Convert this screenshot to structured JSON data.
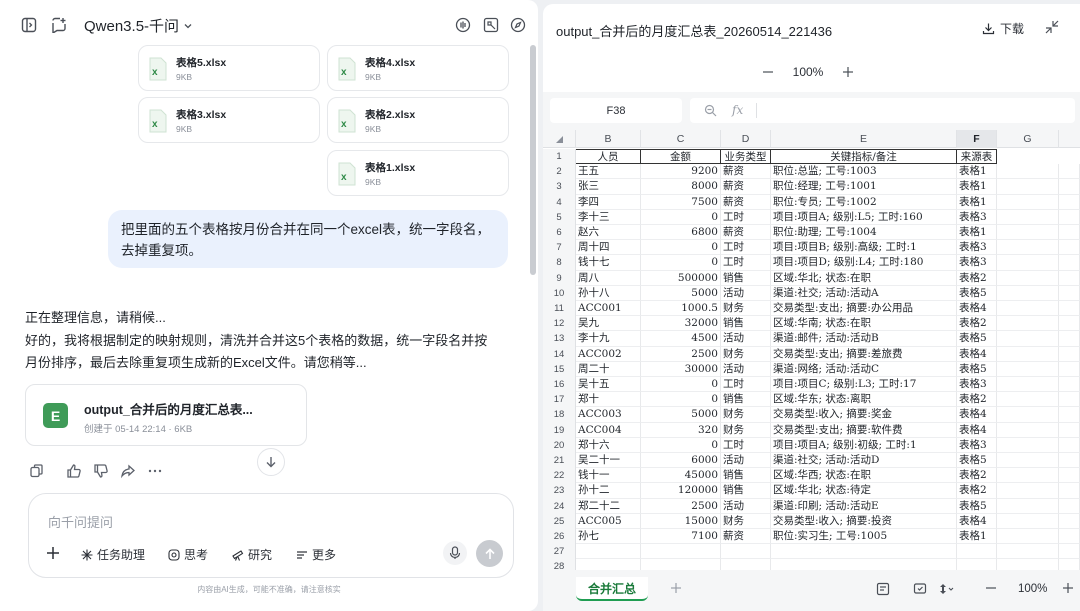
{
  "left": {
    "model_name": "Qwen3.5-千问",
    "files": [
      {
        "name": "表格5.xlsx",
        "size": "9KB"
      },
      {
        "name": "表格4.xlsx",
        "size": "9KB"
      },
      {
        "name": "表格3.xlsx",
        "size": "9KB"
      },
      {
        "name": "表格2.xlsx",
        "size": "9KB"
      },
      {
        "name": "表格1.xlsx",
        "size": "9KB"
      }
    ],
    "user_message_line1": "把里面的五个表格按月份合并在同一个excel表，统一字段名，",
    "user_message_line2": "去掉重复项。",
    "answer_line1": "正在整理信息，请稍候...",
    "answer_line2": "好的，我将根据制定的映射规则，清洗并合并这5个表格的数据，统一字段名并按",
    "answer_line3": "月份排序，最后去除重复项生成新的Excel文件。请您稍等...",
    "card_icon": "E",
    "card_title": "output_合并后的月度汇总表...",
    "card_meta": "创建于 05-14 22:14 · 6KB",
    "input_placeholder": "向千问提问",
    "tools": {
      "task": "任务助理",
      "think": "思考",
      "research": "研究",
      "more": "更多"
    },
    "disclaimer": "内容由AI生成，可能不准确，请注意核实"
  },
  "right": {
    "title": "output_合并后的月度汇总表_20260514_221436",
    "download": "下载",
    "zoom": "100%",
    "cell_ref": "F38",
    "fx": "fx",
    "columns": [
      "B",
      "C",
      "D",
      "E",
      "F",
      "G"
    ],
    "header_row": [
      "人员",
      "金额",
      "业务类型",
      "关键指标/备注",
      "来源表"
    ],
    "rows": [
      [
        "王五",
        "9200",
        "薪资",
        "职位:总监; 工号:1003",
        "表格1"
      ],
      [
        "张三",
        "8000",
        "薪资",
        "职位:经理; 工号:1001",
        "表格1"
      ],
      [
        "李四",
        "7500",
        "薪资",
        "职位:专员; 工号:1002",
        "表格1"
      ],
      [
        "李十三",
        "0",
        "工时",
        "项目:项目A; 级别:L5; 工时:160",
        "表格3"
      ],
      [
        "赵六",
        "6800",
        "薪资",
        "职位:助理; 工号:1004",
        "表格1"
      ],
      [
        "周十四",
        "0",
        "工时",
        "项目:项目B; 级别:高级; 工时:1",
        "表格3"
      ],
      [
        "钱十七",
        "0",
        "工时",
        "项目:项目D; 级别:L4; 工时:180",
        "表格3"
      ],
      [
        "周八",
        "500000",
        "销售",
        "区域:华北; 状态:在职",
        "表格2"
      ],
      [
        "孙十八",
        "5000",
        "活动",
        "渠道:社交; 活动:活动A",
        "表格5"
      ],
      [
        "ACC001",
        "1000.5",
        "财务",
        "交易类型:支出; 摘要:办公用品",
        "表格4"
      ],
      [
        "吴九",
        "32000",
        "销售",
        "区域:华南; 状态:在职",
        "表格2"
      ],
      [
        "李十九",
        "4500",
        "活动",
        "渠道:邮件; 活动:活动B",
        "表格5"
      ],
      [
        "ACC002",
        "2500",
        "财务",
        "交易类型:支出; 摘要:差旅费",
        "表格4"
      ],
      [
        "周二十",
        "30000",
        "活动",
        "渠道:网络; 活动:活动C",
        "表格5"
      ],
      [
        "吴十五",
        "0",
        "工时",
        "项目:项目C; 级别:L3; 工时:17",
        "表格3"
      ],
      [
        "郑十",
        "0",
        "销售",
        "区域:华东; 状态:离职",
        "表格2"
      ],
      [
        "ACC003",
        "5000",
        "财务",
        "交易类型:收入; 摘要:奖金",
        "表格4"
      ],
      [
        "ACC004",
        "320",
        "财务",
        "交易类型:支出; 摘要:软件费",
        "表格4"
      ],
      [
        "郑十六",
        "0",
        "工时",
        "项目:项目A; 级别:初级; 工时:1",
        "表格3"
      ],
      [
        "吴二十一",
        "6000",
        "活动",
        "渠道:社交; 活动:活动D",
        "表格5"
      ],
      [
        "钱十一",
        "45000",
        "销售",
        "区域:华西; 状态:在职",
        "表格2"
      ],
      [
        "孙十二",
        "120000",
        "销售",
        "区域:华北; 状态:待定",
        "表格2"
      ],
      [
        "郑二十二",
        "2500",
        "活动",
        "渠道:印刷; 活动:活动E",
        "表格5"
      ],
      [
        "ACC005",
        "15000",
        "财务",
        "交易类型:收入; 摘要:投资",
        "表格4"
      ],
      [
        "孙七",
        "7100",
        "薪资",
        "职位:实习生; 工号:1005",
        "表格1"
      ]
    ],
    "sheet_tab": "合并汇总",
    "zoom_bottom": "100%"
  }
}
